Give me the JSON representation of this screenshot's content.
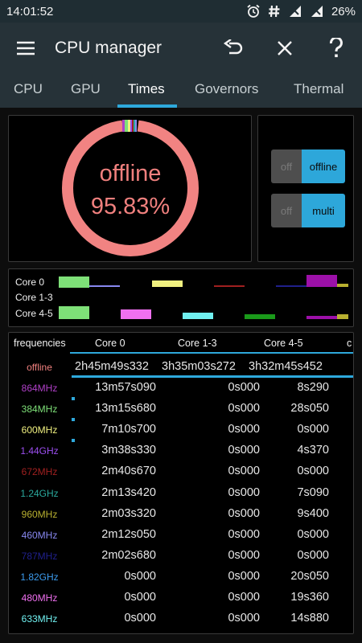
{
  "status": {
    "time": "14:01:52",
    "battery": "26%"
  },
  "appbar": {
    "title": "CPU manager",
    "icons": [
      "menu-icon",
      "undo-icon",
      "close-icon",
      "help-icon"
    ]
  },
  "tabs": [
    "CPU",
    "GPU",
    "Times",
    "Governors",
    "Thermal"
  ],
  "active_tab": "Times",
  "donut": {
    "label": "offline",
    "value": "95.83%",
    "color": "#f18382"
  },
  "toggles": [
    {
      "off": "off",
      "on": "offline"
    },
    {
      "off": "off",
      "on": "multi"
    }
  ],
  "timeline": {
    "rows": [
      "Core 0",
      "Core 1-3",
      "Core 4-5"
    ]
  },
  "table": {
    "headers": [
      "frequencies",
      "Core 0",
      "Core 1-3",
      "Core 4-5"
    ],
    "rows": [
      {
        "freq": "offline",
        "color": "#f0807e",
        "c0": "2h45m49s332",
        "c1": "3h35m03s272",
        "c2": "3h32m45s452"
      },
      {
        "freq": "864MHz",
        "color": "#b040c8",
        "c0": "13m57s090",
        "c1": "0s000",
        "c2": "8s290"
      },
      {
        "freq": "384MHz",
        "color": "#7ee078",
        "c0": "13m15s680",
        "c1": "0s000",
        "c2": "28s050"
      },
      {
        "freq": "600MHz",
        "color": "#f0f080",
        "c0": "7m10s700",
        "c1": "0s000",
        "c2": "0s000"
      },
      {
        "freq": "1.44GHz",
        "color": "#9c4ef0",
        "c0": "3m38s330",
        "c1": "0s000",
        "c2": "4s370"
      },
      {
        "freq": "672MHz",
        "color": "#a02020",
        "c0": "2m40s670",
        "c1": "0s000",
        "c2": "0s000"
      },
      {
        "freq": "1.24GHz",
        "color": "#2aa89c",
        "c0": "2m13s420",
        "c1": "0s000",
        "c2": "7s090"
      },
      {
        "freq": "960MHz",
        "color": "#b8b030",
        "c0": "2m03s320",
        "c1": "0s000",
        "c2": "9s400"
      },
      {
        "freq": "460MHz",
        "color": "#8888f0",
        "c0": "2m12s050",
        "c1": "0s000",
        "c2": "0s000"
      },
      {
        "freq": "787MHz",
        "color": "#20208c",
        "c0": "2m02s680",
        "c1": "0s000",
        "c2": "0s000"
      },
      {
        "freq": "1.82GHz",
        "color": "#3c9cf0",
        "c0": "0s000",
        "c1": "0s000",
        "c2": "20s050"
      },
      {
        "freq": "480MHz",
        "color": "#f070f0",
        "c0": "0s000",
        "c1": "0s000",
        "c2": "19s360"
      },
      {
        "freq": "633MHz",
        "color": "#70f0f0",
        "c0": "0s000",
        "c1": "0s000",
        "c2": "14s880"
      }
    ]
  }
}
